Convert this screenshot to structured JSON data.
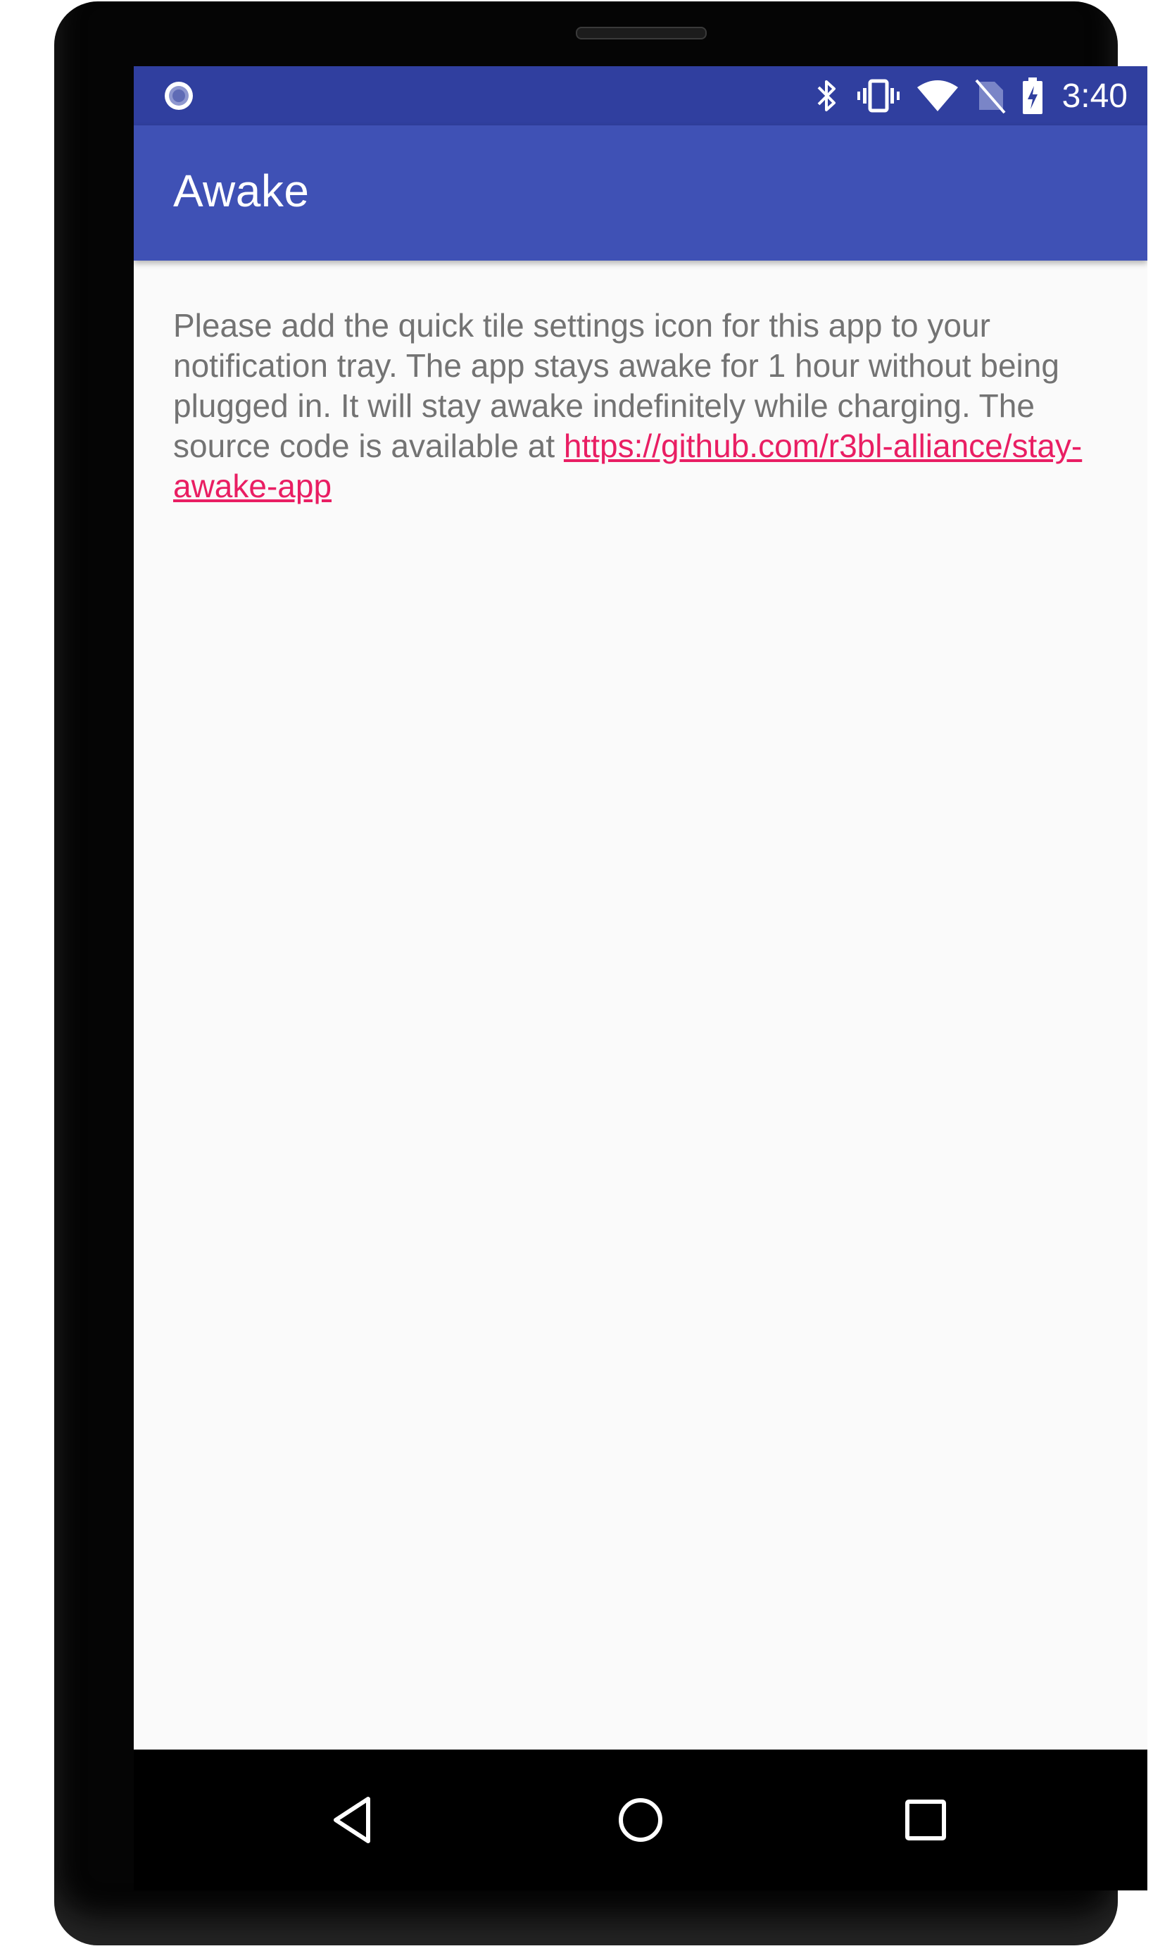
{
  "status_bar": {
    "time": "3:40",
    "icons": [
      "notification-circle-icon",
      "bluetooth-icon",
      "vibrate-icon",
      "wifi-icon",
      "no-sim-icon",
      "battery-charging-icon"
    ]
  },
  "app_bar": {
    "title": "Awake"
  },
  "content": {
    "message": "Please add the quick tile settings icon for this app to your notification tray. The app stays awake for 1 hour without being plugged in. It will stay awake indefinitely while charging. The source code is available at",
    "link": "https://github.com/r3bl-alliance/stay-awake-app"
  },
  "nav_bar": {
    "icons": [
      "back-icon",
      "home-icon",
      "recents-icon"
    ]
  },
  "colors": {
    "status_bar": "#303f9f",
    "app_bar": "#3f51b5",
    "background": "#fafafa",
    "text": "#737373",
    "link": "#e91e63"
  }
}
